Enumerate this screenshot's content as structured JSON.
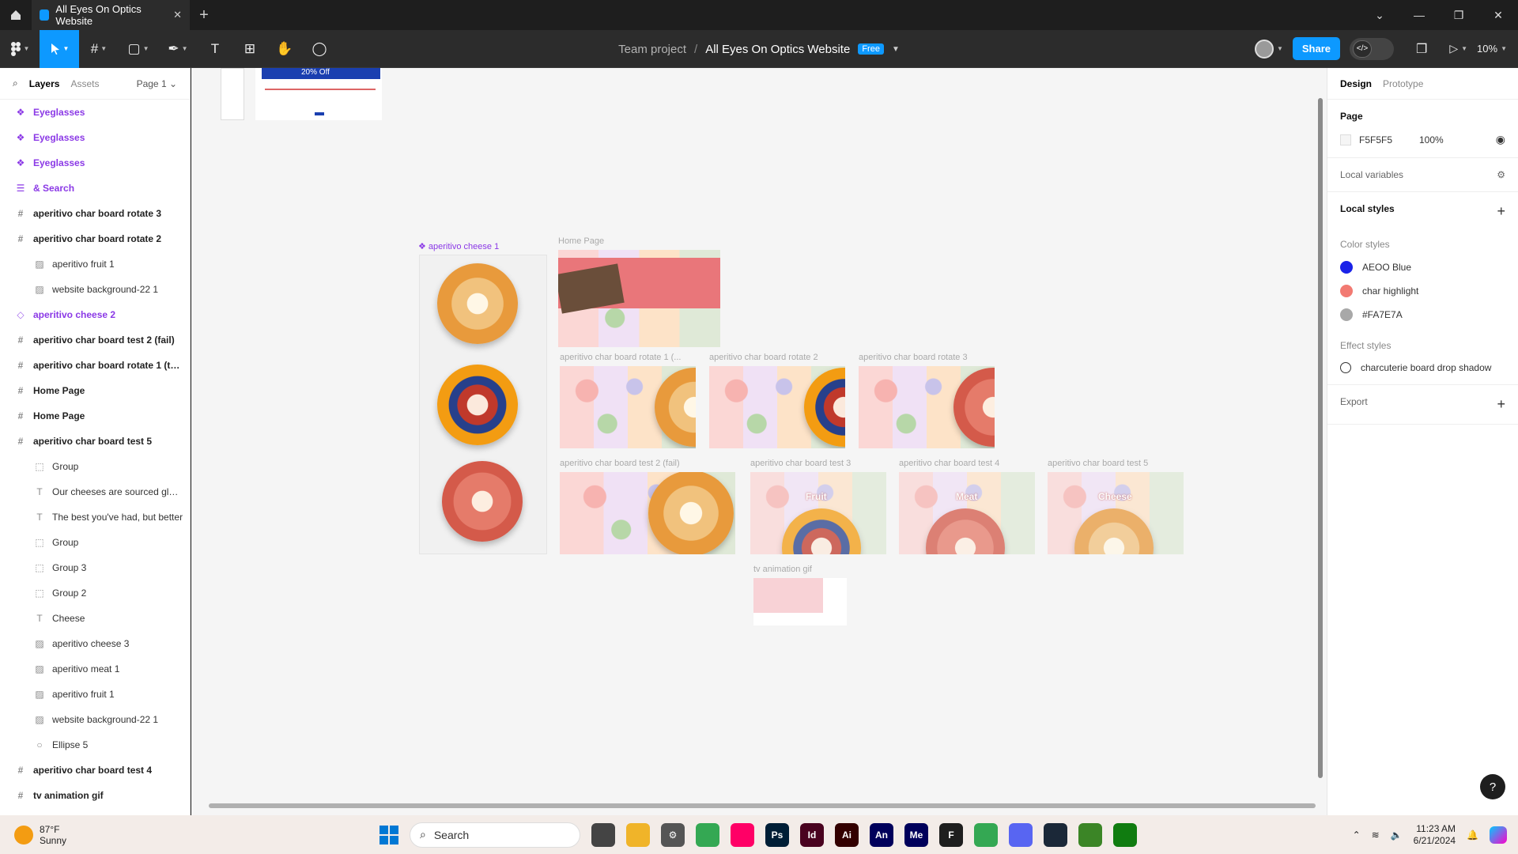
{
  "browser": {
    "tab_title": "All Eyes On Optics Website",
    "close": "✕",
    "new_tab": "+",
    "window": {
      "min": "—",
      "restore": "❐",
      "close": "✕",
      "dropdown": "⌄"
    }
  },
  "toolbar": {
    "team": "Team project",
    "separator": "/",
    "file": "All Eyes On Optics Website",
    "plan_badge": "Free",
    "share": "Share",
    "dev_mode": "</>",
    "zoom": "10%"
  },
  "left_panel": {
    "tabs": {
      "layers": "Layers",
      "assets": "Assets",
      "page": "Page 1 ⌄"
    },
    "layers": [
      {
        "name": "Eyeglasses",
        "kind": "comp",
        "indent": 0
      },
      {
        "name": "Eyeglasses",
        "kind": "comp",
        "indent": 0
      },
      {
        "name": "Eyeglasses",
        "kind": "comp",
        "indent": 0
      },
      {
        "name": "& Search",
        "kind": "comp-list",
        "indent": 0
      },
      {
        "name": "aperitivo char board rotate 3",
        "kind": "frame",
        "indent": 0
      },
      {
        "name": "aperitivo char board rotate 2",
        "kind": "frame",
        "indent": 0
      },
      {
        "name": "aperitivo fruit 1",
        "kind": "image",
        "indent": 1
      },
      {
        "name": "website background-22 1",
        "kind": "image",
        "indent": 1
      },
      {
        "name": "aperitivo cheese 2",
        "kind": "instance",
        "indent": 0
      },
      {
        "name": "aperitivo char board test 2 (fail)",
        "kind": "frame",
        "indent": 0
      },
      {
        "name": "aperitivo char board rotate 1 (test ...",
        "kind": "frame",
        "indent": 0
      },
      {
        "name": "Home Page",
        "kind": "frame",
        "indent": 0
      },
      {
        "name": "Home Page",
        "kind": "frame",
        "indent": 0
      },
      {
        "name": "aperitivo char board test 5",
        "kind": "frame",
        "indent": 0
      },
      {
        "name": "Group",
        "kind": "group",
        "indent": 1
      },
      {
        "name": "Our cheeses are sourced glob...",
        "kind": "text",
        "indent": 1
      },
      {
        "name": "The best you've had, but better",
        "kind": "text",
        "indent": 1
      },
      {
        "name": "Group",
        "kind": "group",
        "indent": 1
      },
      {
        "name": "Group 3",
        "kind": "group",
        "indent": 1
      },
      {
        "name": "Group 2",
        "kind": "group",
        "indent": 1
      },
      {
        "name": "Cheese",
        "kind": "text",
        "indent": 1
      },
      {
        "name": "aperitivo cheese 3",
        "kind": "image",
        "indent": 1
      },
      {
        "name": "aperitivo meat 1",
        "kind": "image",
        "indent": 1
      },
      {
        "name": "aperitivo fruit 1",
        "kind": "image",
        "indent": 1
      },
      {
        "name": "website background-22 1",
        "kind": "image",
        "indent": 1
      },
      {
        "name": "Ellipse 5",
        "kind": "ellipse",
        "indent": 1
      },
      {
        "name": "aperitivo char board test 4",
        "kind": "frame",
        "indent": 0
      },
      {
        "name": "tv animation gif",
        "kind": "frame",
        "indent": 0
      }
    ]
  },
  "canvas": {
    "labels": {
      "cheese1": "❖ aperitivo cheese 1",
      "home": "Home Page",
      "rotate1": "aperitivo char board rotate 1 (...",
      "rotate2": "aperitivo char board rotate 2",
      "rotate3": "aperitivo char board rotate 3",
      "test2": "aperitivo char board test 2 (fail)",
      "test3": "aperitivo char board test 3",
      "test4": "aperitivo char board test 4",
      "test5": "aperitivo char board test 5",
      "tv": "tv animation gif"
    },
    "frame_text": {
      "promo": "20% Off",
      "fruit": "Fruit",
      "meat": "Meat",
      "cheese": "Cheese"
    }
  },
  "right_panel": {
    "tabs": {
      "design": "Design",
      "prototype": "Prototype"
    },
    "page": {
      "title": "Page",
      "color": "F5F5F5",
      "opacity": "100%"
    },
    "local_variables": "Local variables",
    "local_styles": "Local styles",
    "color_styles_title": "Color styles",
    "color_styles": [
      {
        "name": "AEOO Blue",
        "color": "#1a22e8"
      },
      {
        "name": "char highlight",
        "color": "#f27a72"
      },
      {
        "name": "#FA7E7A",
        "color": "#a8a8a8"
      }
    ],
    "effect_styles_title": "Effect styles",
    "effect_style": "charcuterie board drop shadow",
    "export": "Export",
    "help": "?"
  },
  "taskbar": {
    "temp": "87°F",
    "condition": "Sunny",
    "search": "Search",
    "time": "11:23 AM",
    "date": "6/21/2024",
    "apps": [
      {
        "label": "",
        "color": "#444"
      },
      {
        "label": "",
        "color": "#f0b429"
      },
      {
        "label": "⚙",
        "color": "#555"
      },
      {
        "label": "",
        "color": "#34a853"
      },
      {
        "label": "",
        "color": "#f06"
      },
      {
        "label": "Ps",
        "color": "#001e36"
      },
      {
        "label": "Id",
        "color": "#49021f"
      },
      {
        "label": "Ai",
        "color": "#330000"
      },
      {
        "label": "An",
        "color": "#00005b"
      },
      {
        "label": "Me",
        "color": "#00005b"
      },
      {
        "label": "F",
        "color": "#1e1e1e"
      },
      {
        "label": "",
        "color": "#34a853"
      },
      {
        "label": "",
        "color": "#5865f2"
      },
      {
        "label": "",
        "color": "#1b2838"
      },
      {
        "label": "",
        "color": "#3b8526"
      },
      {
        "label": "",
        "color": "#107c10"
      }
    ]
  }
}
